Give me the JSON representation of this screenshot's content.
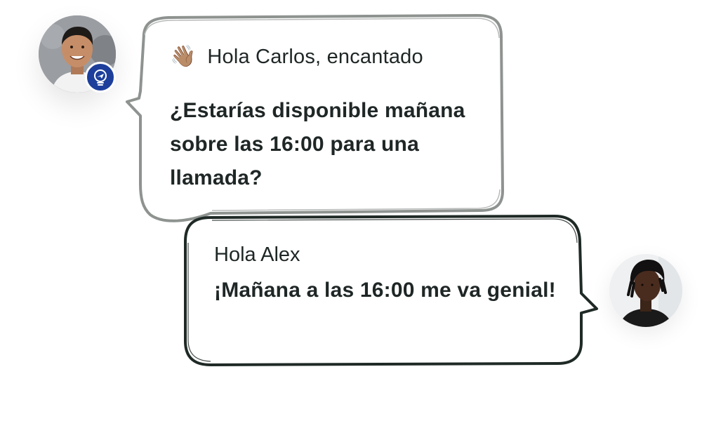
{
  "messages": [
    {
      "sender": "alex",
      "icon": "waving-hand-icon",
      "greeting": "Hola Carlos, encantado",
      "body": "¿Estarías disponible mañana sobre las 16:00 para una llamada?"
    },
    {
      "sender": "carlos",
      "greeting": "Hola Alex",
      "body": "¡Mañana a las 16:00 me va genial!"
    }
  ],
  "colors": {
    "text": "#1f2626",
    "bubble_1_border": "#8e9390",
    "bubble_2_border": "#1f2a26",
    "badge": "#1d3f9b"
  }
}
